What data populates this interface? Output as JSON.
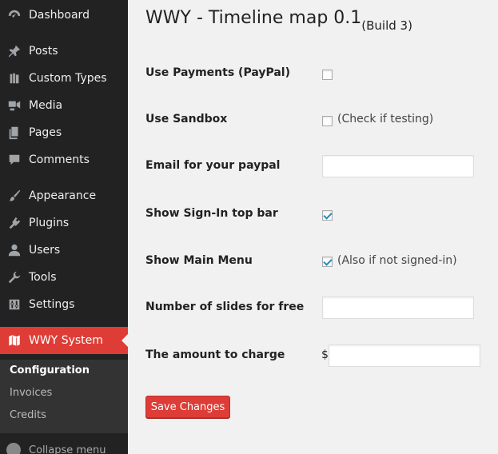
{
  "sidebar": {
    "items": [
      {
        "label": "Dashboard",
        "icon": "dashboard-icon"
      },
      {
        "label": "Posts",
        "icon": "pin-icon"
      },
      {
        "label": "Custom Types",
        "icon": "custom-types-icon"
      },
      {
        "label": "Media",
        "icon": "media-icon"
      },
      {
        "label": "Pages",
        "icon": "pages-icon"
      },
      {
        "label": "Comments",
        "icon": "comments-icon"
      },
      {
        "label": "Appearance",
        "icon": "brush-icon"
      },
      {
        "label": "Plugins",
        "icon": "plugin-icon"
      },
      {
        "label": "Users",
        "icon": "user-icon"
      },
      {
        "label": "Tools",
        "icon": "wrench-icon"
      },
      {
        "label": "Settings",
        "icon": "settings-icon"
      },
      {
        "label": "WWY System",
        "icon": "map-icon"
      }
    ],
    "submenu": [
      "Configuration",
      "Invoices",
      "Credits"
    ],
    "collapse_label": "Collapse menu"
  },
  "page": {
    "title": "WWY - Timeline map 0.1",
    "build": "(Build 3)"
  },
  "form": {
    "use_payments": {
      "label": "Use Payments (PayPal)",
      "checked": false
    },
    "use_sandbox": {
      "label": "Use Sandbox",
      "checked": false,
      "hint": "(Check if testing)"
    },
    "email": {
      "label": "Email for your paypal",
      "value": ""
    },
    "show_signin": {
      "label": "Show Sign-In top bar",
      "checked": true
    },
    "show_menu": {
      "label": "Show Main Menu",
      "checked": true,
      "hint": "(Also if not signed-in)"
    },
    "slides": {
      "label": "Number of slides for free",
      "value": ""
    },
    "amount": {
      "label": "The amount to charge",
      "currency": "$",
      "value": ""
    },
    "save_label": "Save Changes"
  },
  "colors": {
    "accent": "#dd3d36",
    "sidebar_bg": "#222222",
    "submenu_bg": "#333333",
    "content_bg": "#f1f1f1"
  }
}
